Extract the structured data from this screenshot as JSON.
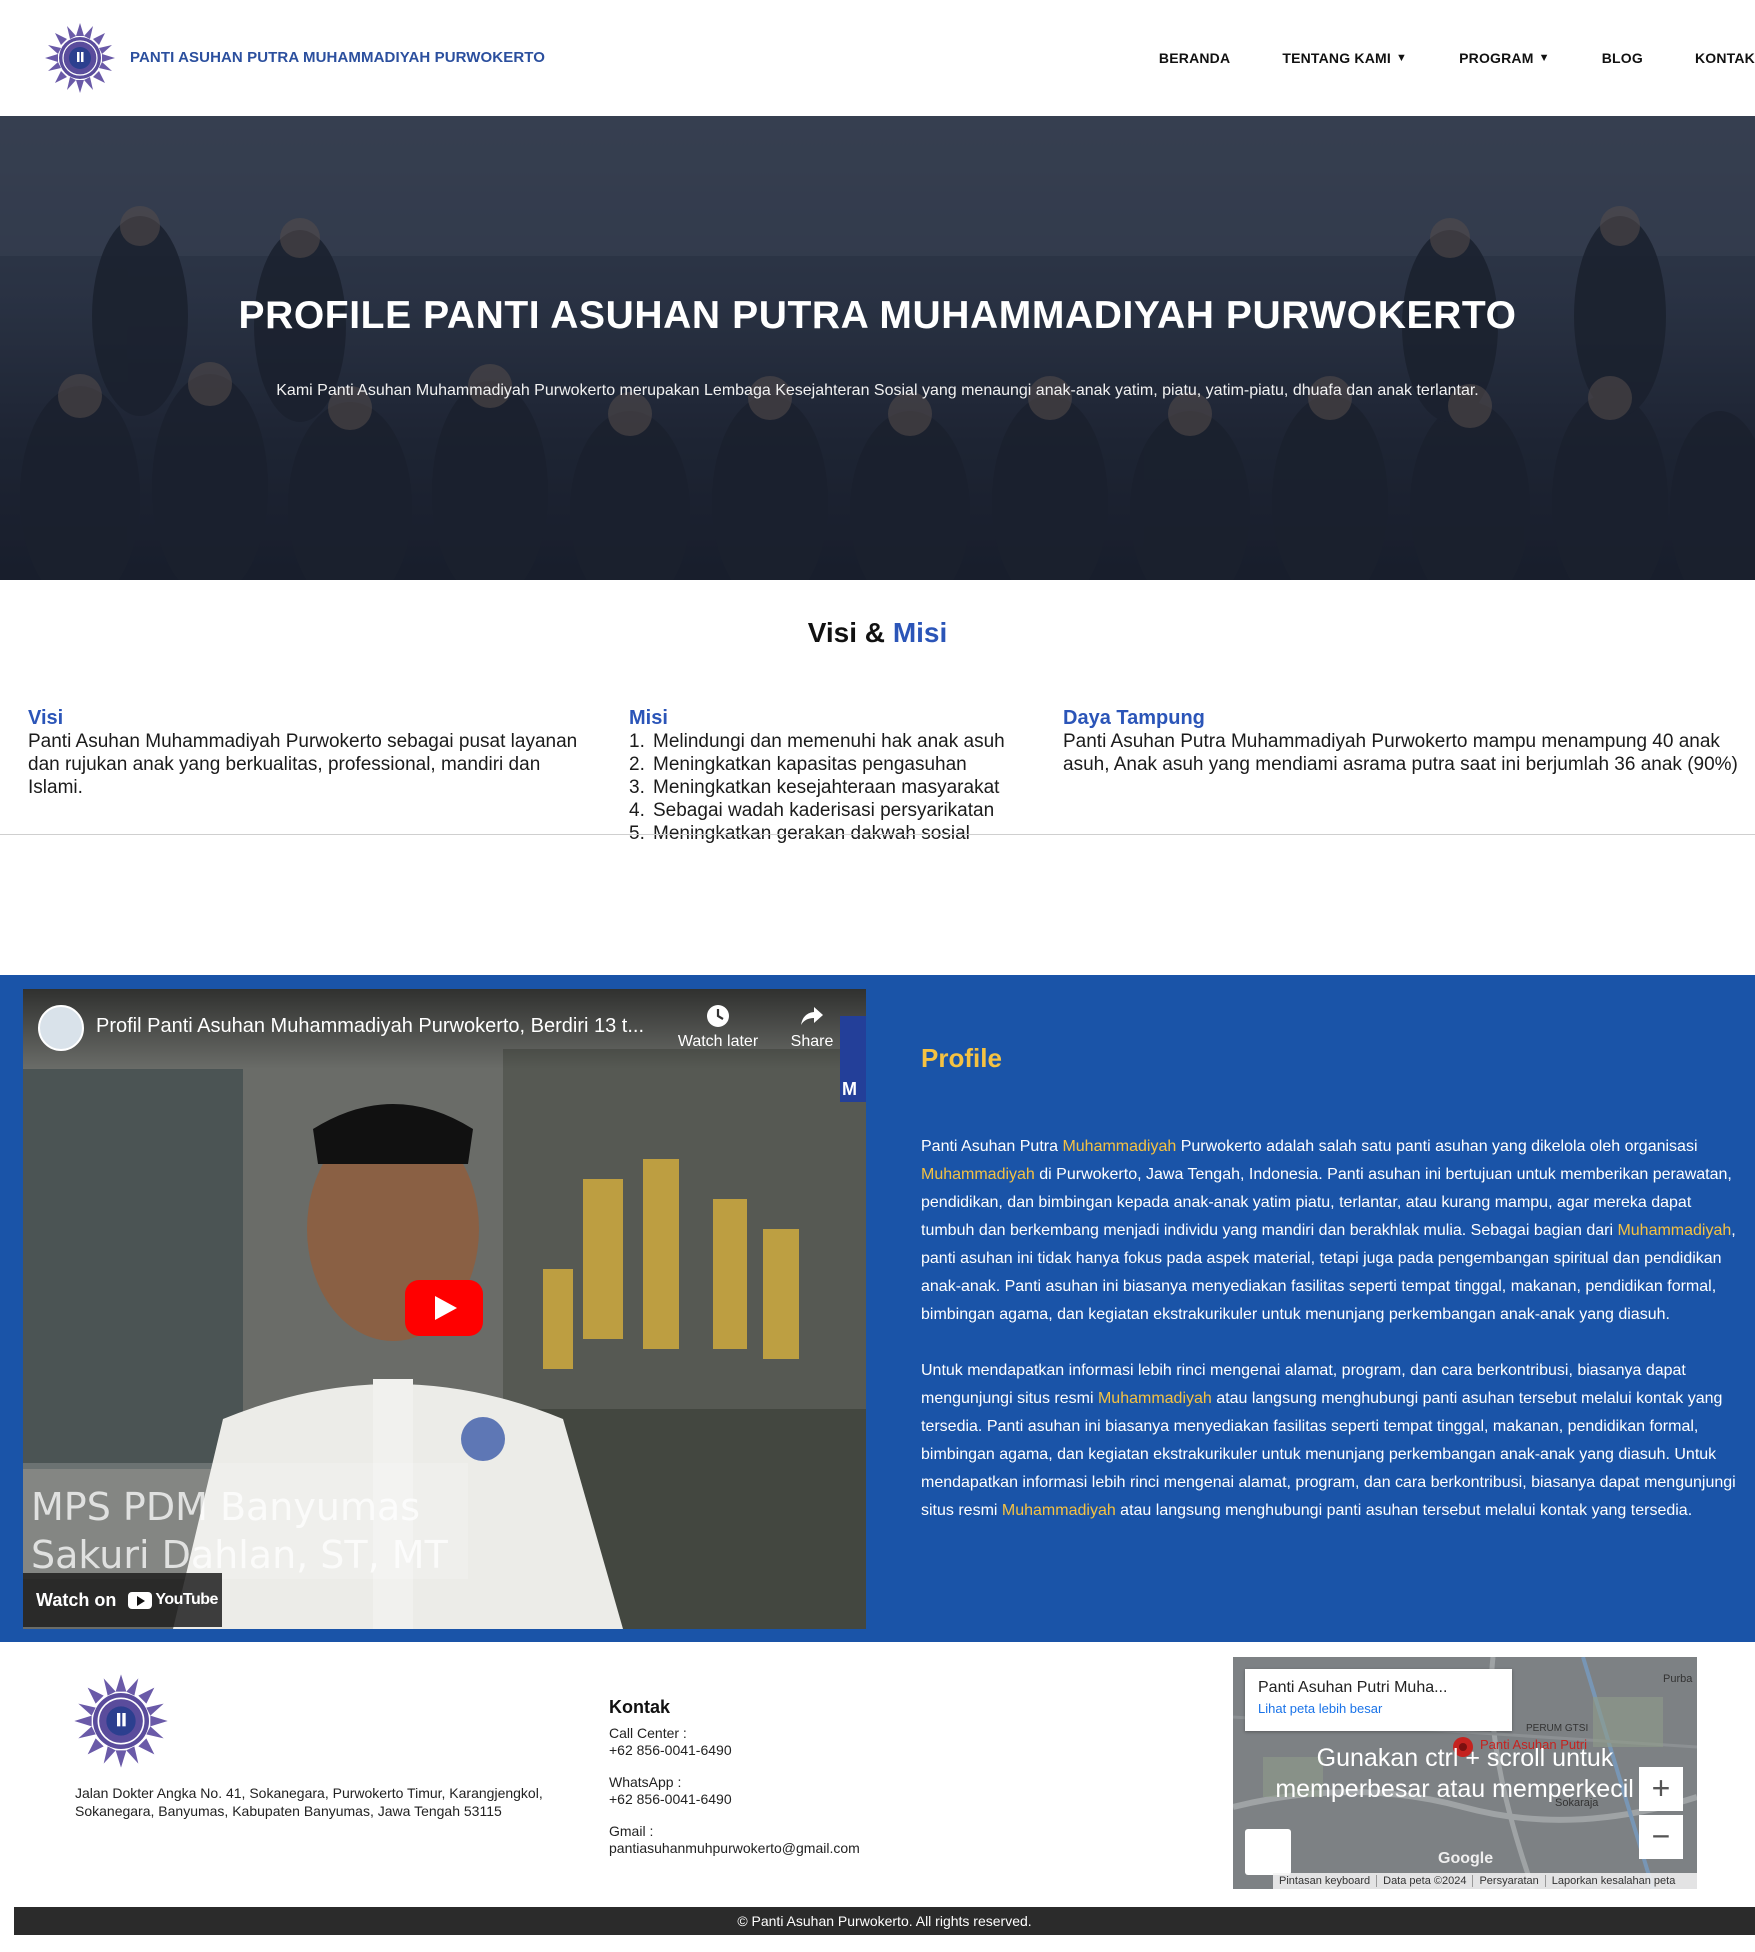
{
  "header": {
    "site_name": "PANTI ASUHAN PUTRA MUHAMMADIYAH PURWOKERTO",
    "nav": [
      {
        "label": "BERANDA",
        "caret": ""
      },
      {
        "label": "TENTANG KAMI",
        "caret": "▼"
      },
      {
        "label": "PROGRAM",
        "caret": "▼"
      },
      {
        "label": "BLOG",
        "caret": ""
      },
      {
        "label": "KONTAK",
        "caret": ""
      }
    ]
  },
  "hero": {
    "title": "PROFILE PANTI ASUHAN PUTRA MUHAMMADIYAH PURWOKERTO",
    "subtitle": "Kami Panti Asuhan Muhammadiyah Purwokerto merupakan Lembaga Kesejahteran Sosial yang menaungi anak-anak yatim, piatu, yatim-piatu, dhuafa dan anak terlantar."
  },
  "visi_misi": {
    "heading_part1": "Visi &",
    "heading_part2": "Misi",
    "visi_title": "Visi",
    "visi_text": "Panti Asuhan Muhammadiyah Purwokerto sebagai pusat layanan dan rujukan anak yang berkualitas, professional, mandiri dan Islami.",
    "misi_title": "Misi",
    "misi_items": [
      {
        "num": "1.",
        "text": "Melindungi dan memenuhi hak anak asuh"
      },
      {
        "num": "2.",
        "text": "Meningkatkan kapasitas pengasuhan"
      },
      {
        "num": "3.",
        "text": "Meningkatkan kesejahteraan masyarakat"
      },
      {
        "num": "4.",
        "text": "Sebagai wadah kaderisasi persyarikatan"
      },
      {
        "num": "5.",
        "text": "Meningkatkan gerakan dakwah sosial"
      }
    ],
    "daya_title": "Daya Tampung",
    "daya_text": "Panti Asuhan Putra Muhammadiyah Purwokerto mampu menampung 40 anak asuh, Anak asuh yang mendiami asrama putra saat ini berjumlah 36 anak (90%)"
  },
  "video": {
    "title": "Profil Panti Asuhan Muhammadiyah Purwokerto, Berdiri 13 t...",
    "watch_later": "Watch later",
    "share": "Share",
    "caption_line1": "MPS PDM Banyumas",
    "caption_line2": "Sakuri Dahlan, ST, MT",
    "watch_on": "Watch on",
    "youtube": "YouTube",
    "brand_letter": "M",
    "badge": "MUHAMMADIYAH"
  },
  "profile": {
    "title": "Profile",
    "p1": [
      "Panti Asuhan Putra ",
      "Muhammadiyah",
      " Purwokerto adalah salah satu panti asuhan yang dikelola oleh organisasi ",
      "Muhammadiyah",
      " di Purwokerto, Jawa Tengah, Indonesia. Panti asuhan ini bertujuan untuk memberikan perawatan, pendidikan, dan bimbingan kepada anak-anak yatim piatu, terlantar, atau kurang mampu, agar mereka dapat tumbuh dan berkembang menjadi individu yang mandiri dan berakhlak mulia. Sebagai bagian dari ",
      "Muhammadiyah",
      ", panti asuhan ini tidak hanya fokus pada aspek material, tetapi juga pada pengembangan spiritual dan pendidikan anak-anak. Panti asuhan ini biasanya menyediakan fasilitas seperti tempat tinggal, makanan, pendidikan formal, bimbingan agama, dan kegiatan ekstrakurikuler untuk menunjang perkembangan anak-anak yang diasuh."
    ],
    "p2": [
      "Untuk mendapatkan informasi lebih rinci mengenai alamat, program, dan cara berkontribusi, biasanya dapat mengunjungi situs resmi ",
      "Muhammadiyah",
      " atau langsung menghubungi panti asuhan tersebut melalui kontak yang tersedia. Panti asuhan ini biasanya menyediakan fasilitas seperti tempat tinggal, makanan, pendidikan formal, bimbingan agama, dan kegiatan ekstrakurikuler untuk menunjang perkembangan anak-anak yang diasuh. Untuk mendapatkan informasi lebih rinci mengenai alamat, program, dan cara berkontribusi, biasanya dapat mengunjungi situs resmi ",
      "Muhammadiyah",
      " atau langsung menghubungi panti asuhan tersebut melalui kontak yang tersedia."
    ]
  },
  "footer": {
    "address": "Jalan Dokter Angka No. 41, Sokanegara, Purwokerto Timur, Karangjengkol, Sokanegara, Banyumas, Kabupaten Banyumas, Jawa Tengah 53115",
    "kontak_title": "Kontak",
    "call_label": "Call Center :",
    "call_value": "+62 856-0041-6490",
    "wa_label": "WhatsApp :",
    "wa_value": "+62 856-0041-6490",
    "gmail_label": "Gmail :",
    "gmail_value": "pantiasuhanmuhpurwokerto@gmail.com",
    "copyright": "© Panti Asuhan Purwokerto. All rights reserved."
  },
  "map": {
    "place": "Panti Asuhan Putri Muha...",
    "link": "Lihat peta lebih besar",
    "hint_line1": "Gunakan ctrl + scroll untuk",
    "hint_line2": "memperbesar atau memperkecil p",
    "zoom_in": "+",
    "zoom_out": "−",
    "label_purba": "Purba",
    "label_perum": "PERUM GTSI",
    "label_pin": "Panti Asuhan Putri",
    "label_sokaraja": "Sokaraja",
    "google": "Google",
    "bar": [
      "Pintasan keyboard",
      "Data peta ©2024",
      "Persyaratan",
      "Laporkan kesalahan peta"
    ]
  },
  "colors": {
    "brand_blue": "#1a54a8",
    "accent_yellow": "#f5c242",
    "heading_blue": "#2b55b8"
  }
}
